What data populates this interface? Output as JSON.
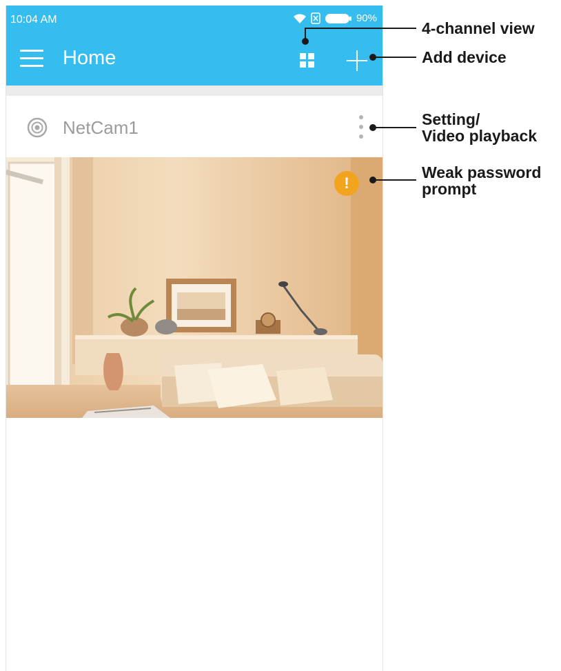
{
  "status_bar": {
    "time": "10:04 AM",
    "battery": "90%"
  },
  "toolbar": {
    "title": "Home"
  },
  "device": {
    "name": "NetCam1"
  },
  "preview": {
    "warning_glyph": "!"
  },
  "annotations": {
    "four_channel": "4-channel view",
    "add_device": "Add device",
    "setting_line1": "Setting/",
    "setting_line2": "Video playback",
    "weak_line1": "Weak password",
    "weak_line2": "prompt"
  },
  "icons": [
    "menu-icon",
    "four-channel-grid-icon",
    "add-plus-icon",
    "camera-icon",
    "more-vert-icon",
    "warning-icon",
    "wifi-icon",
    "sim-icon",
    "battery-icon"
  ],
  "colors": {
    "app_bar": "#35bdef",
    "warning": "#f2a41e",
    "device_text": "#9b9b9b"
  }
}
